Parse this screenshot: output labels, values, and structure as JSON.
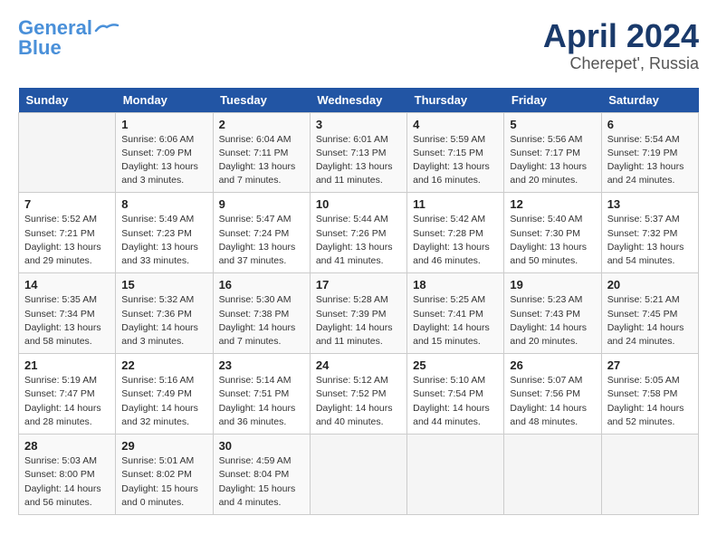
{
  "logo": {
    "line1": "General",
    "line2": "Blue"
  },
  "title": "April 2024",
  "location": "Cherepet', Russia",
  "days_header": [
    "Sunday",
    "Monday",
    "Tuesday",
    "Wednesday",
    "Thursday",
    "Friday",
    "Saturday"
  ],
  "weeks": [
    [
      {
        "num": "",
        "info": ""
      },
      {
        "num": "1",
        "info": "Sunrise: 6:06 AM\nSunset: 7:09 PM\nDaylight: 13 hours\nand 3 minutes."
      },
      {
        "num": "2",
        "info": "Sunrise: 6:04 AM\nSunset: 7:11 PM\nDaylight: 13 hours\nand 7 minutes."
      },
      {
        "num": "3",
        "info": "Sunrise: 6:01 AM\nSunset: 7:13 PM\nDaylight: 13 hours\nand 11 minutes."
      },
      {
        "num": "4",
        "info": "Sunrise: 5:59 AM\nSunset: 7:15 PM\nDaylight: 13 hours\nand 16 minutes."
      },
      {
        "num": "5",
        "info": "Sunrise: 5:56 AM\nSunset: 7:17 PM\nDaylight: 13 hours\nand 20 minutes."
      },
      {
        "num": "6",
        "info": "Sunrise: 5:54 AM\nSunset: 7:19 PM\nDaylight: 13 hours\nand 24 minutes."
      }
    ],
    [
      {
        "num": "7",
        "info": "Sunrise: 5:52 AM\nSunset: 7:21 PM\nDaylight: 13 hours\nand 29 minutes."
      },
      {
        "num": "8",
        "info": "Sunrise: 5:49 AM\nSunset: 7:23 PM\nDaylight: 13 hours\nand 33 minutes."
      },
      {
        "num": "9",
        "info": "Sunrise: 5:47 AM\nSunset: 7:24 PM\nDaylight: 13 hours\nand 37 minutes."
      },
      {
        "num": "10",
        "info": "Sunrise: 5:44 AM\nSunset: 7:26 PM\nDaylight: 13 hours\nand 41 minutes."
      },
      {
        "num": "11",
        "info": "Sunrise: 5:42 AM\nSunset: 7:28 PM\nDaylight: 13 hours\nand 46 minutes."
      },
      {
        "num": "12",
        "info": "Sunrise: 5:40 AM\nSunset: 7:30 PM\nDaylight: 13 hours\nand 50 minutes."
      },
      {
        "num": "13",
        "info": "Sunrise: 5:37 AM\nSunset: 7:32 PM\nDaylight: 13 hours\nand 54 minutes."
      }
    ],
    [
      {
        "num": "14",
        "info": "Sunrise: 5:35 AM\nSunset: 7:34 PM\nDaylight: 13 hours\nand 58 minutes."
      },
      {
        "num": "15",
        "info": "Sunrise: 5:32 AM\nSunset: 7:36 PM\nDaylight: 14 hours\nand 3 minutes."
      },
      {
        "num": "16",
        "info": "Sunrise: 5:30 AM\nSunset: 7:38 PM\nDaylight: 14 hours\nand 7 minutes."
      },
      {
        "num": "17",
        "info": "Sunrise: 5:28 AM\nSunset: 7:39 PM\nDaylight: 14 hours\nand 11 minutes."
      },
      {
        "num": "18",
        "info": "Sunrise: 5:25 AM\nSunset: 7:41 PM\nDaylight: 14 hours\nand 15 minutes."
      },
      {
        "num": "19",
        "info": "Sunrise: 5:23 AM\nSunset: 7:43 PM\nDaylight: 14 hours\nand 20 minutes."
      },
      {
        "num": "20",
        "info": "Sunrise: 5:21 AM\nSunset: 7:45 PM\nDaylight: 14 hours\nand 24 minutes."
      }
    ],
    [
      {
        "num": "21",
        "info": "Sunrise: 5:19 AM\nSunset: 7:47 PM\nDaylight: 14 hours\nand 28 minutes."
      },
      {
        "num": "22",
        "info": "Sunrise: 5:16 AM\nSunset: 7:49 PM\nDaylight: 14 hours\nand 32 minutes."
      },
      {
        "num": "23",
        "info": "Sunrise: 5:14 AM\nSunset: 7:51 PM\nDaylight: 14 hours\nand 36 minutes."
      },
      {
        "num": "24",
        "info": "Sunrise: 5:12 AM\nSunset: 7:52 PM\nDaylight: 14 hours\nand 40 minutes."
      },
      {
        "num": "25",
        "info": "Sunrise: 5:10 AM\nSunset: 7:54 PM\nDaylight: 14 hours\nand 44 minutes."
      },
      {
        "num": "26",
        "info": "Sunrise: 5:07 AM\nSunset: 7:56 PM\nDaylight: 14 hours\nand 48 minutes."
      },
      {
        "num": "27",
        "info": "Sunrise: 5:05 AM\nSunset: 7:58 PM\nDaylight: 14 hours\nand 52 minutes."
      }
    ],
    [
      {
        "num": "28",
        "info": "Sunrise: 5:03 AM\nSunset: 8:00 PM\nDaylight: 14 hours\nand 56 minutes."
      },
      {
        "num": "29",
        "info": "Sunrise: 5:01 AM\nSunset: 8:02 PM\nDaylight: 15 hours\nand 0 minutes."
      },
      {
        "num": "30",
        "info": "Sunrise: 4:59 AM\nSunset: 8:04 PM\nDaylight: 15 hours\nand 4 minutes."
      },
      {
        "num": "",
        "info": ""
      },
      {
        "num": "",
        "info": ""
      },
      {
        "num": "",
        "info": ""
      },
      {
        "num": "",
        "info": ""
      }
    ]
  ]
}
